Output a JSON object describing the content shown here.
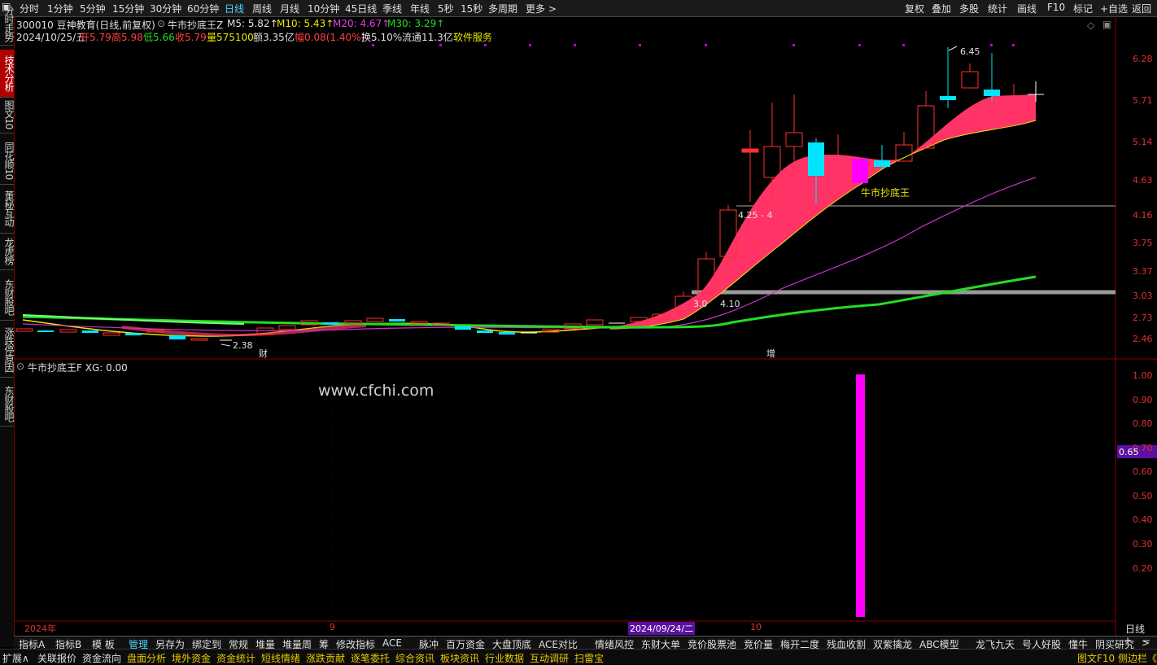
{
  "topbar": {
    "periods": [
      "分时",
      "1分钟",
      "5分钟",
      "15分钟",
      "30分钟",
      "60分钟",
      "日线",
      "周线",
      "月线",
      "10分钟",
      "45日线",
      "季线",
      "年线",
      "5秒",
      "15秒",
      "多周期",
      "更多 >"
    ],
    "active_period": "日线",
    "right_buttons": [
      "复权",
      "叠加",
      "多股",
      "统计",
      "画线",
      "F10",
      "标记",
      "+自选",
      "返回"
    ]
  },
  "sidebar": {
    "items": [
      "分时走势",
      "技术分析",
      "图文10",
      "同花顺10",
      "董秘互动",
      "龙虎榜",
      "东财股吧",
      "涨跌停原因",
      "东财股吧"
    ],
    "selected": "技术分析"
  },
  "header": {
    "stock": "300010 豆神教育(日线,前复权)",
    "indicator": "牛市抄底王Z",
    "ma5": "M5: 5.82↑",
    "ma10": "M10: 5.43↑",
    "ma20": "M20: 4.67↑",
    "ma30": "M30: 3.29↑",
    "date": "2024/10/25/五",
    "open": "开5.79",
    "high": "高5.98",
    "low": "低5.66",
    "close": "收5.79",
    "volume": "量575100",
    "amount": "额3.35亿",
    "change": "幅0.08(1.40%)",
    "turnover": "换5.10%",
    "float": "流通11.3亿",
    "sector": "软件服务"
  },
  "price_axis": [
    "6.28",
    "5.71",
    "5.14",
    "4.63",
    "4.16",
    "3.75",
    "3.37",
    "3.03",
    "2.73",
    "2.46"
  ],
  "lower_axis": [
    "1.00",
    "0.90",
    "0.80",
    "0.70",
    "0.60",
    "0.50",
    "0.40",
    "0.30",
    "0.20"
  ],
  "lower_current": "0.65",
  "annotations": {
    "high_label": "6.45",
    "low_label": "2.38",
    "mid_label": "4.25 - 4",
    "mid_label2": "3.0",
    "mid_label3": "4.10",
    "signal": "牛市抄底王",
    "tag_cai": "财",
    "tag_zeng": "增"
  },
  "lower_panel": {
    "title": "牛市抄底王F  XG: 0.00",
    "watermark": "www.cfchi.com"
  },
  "x_axis": {
    "year": "2024年",
    "m9": "9",
    "highlight_date": "2024/09/24/二",
    "m10": "10",
    "period": "日线"
  },
  "bottom_tabs": [
    "指标A",
    "指标B",
    "模 板",
    "管理",
    "另存为",
    "绑定到",
    "常规",
    "堆量",
    "堆量周",
    "筹",
    "修改指标",
    "ACE",
    "脉冲",
    "百万资金",
    "大盘顶底",
    "ACE对比",
    "情绪风控",
    "东财大单",
    "竞价股票池",
    "竞价量",
    "梅开二度",
    "残血收割",
    "双紫擒龙",
    "ABC模型",
    "龙飞九天",
    "号人好股",
    "懂牛",
    "阴买研究",
    ">"
  ],
  "bottom_tabs_selected": "管理",
  "statusbar": {
    "items": [
      "扩展∧",
      "关联报价",
      "资金流向",
      "盘面分析",
      "境外资金",
      "资金统计",
      "短线情绪",
      "涨跌贡献",
      "逐笔委托",
      "综合资讯",
      "板块资讯",
      "行业数据",
      "互动调研",
      "扫雷宝"
    ],
    "right": "图文F10 侧边栏《"
  },
  "colors": {
    "up": "#ff3030",
    "down": "#00e5ff",
    "ribbon": "#ff3366",
    "ma_green": "#22dd22",
    "ma_magenta": "#cc33cc",
    "signal_bar": "#ff00ff"
  }
}
